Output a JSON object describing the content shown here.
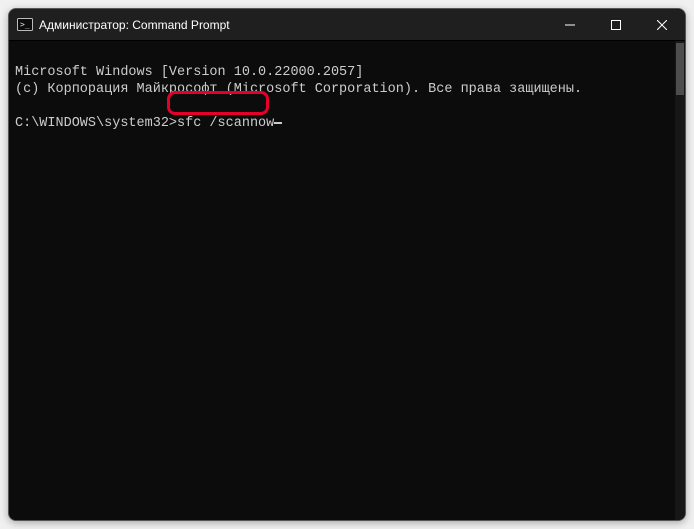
{
  "window": {
    "title": "Администратор: Command Prompt"
  },
  "terminal": {
    "line1": "Microsoft Windows [Version 10.0.22000.2057]",
    "line2": "(c) Корпорация Майкрософт (Microsoft Corporation). Все права защищены.",
    "blank": "",
    "prompt": "C:\\WINDOWS\\system32>",
    "command": "sfc /scannow"
  },
  "highlight": {
    "target": "sfc /scannow"
  },
  "colors": {
    "background": "#0c0c0c",
    "text": "#cccccc",
    "titlebar": "#1f1f1f",
    "highlight_border": "#e4002b"
  }
}
